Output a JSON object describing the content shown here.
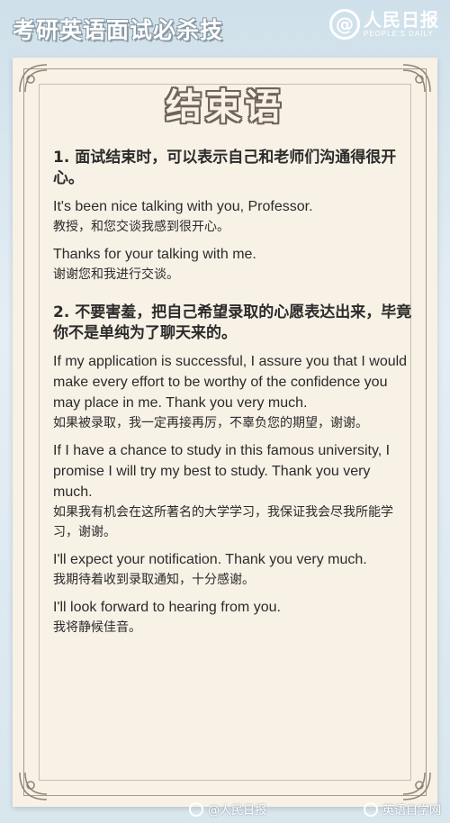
{
  "header": {
    "title": "考研英语面试必杀技",
    "brand_mark": "@",
    "brand_cn": "人民日报",
    "brand_en": "PEOPLE'S DAILY"
  },
  "section_title": "结束语",
  "items": [
    {
      "title": "1. 面试结束时，可以表示自己和老师们沟通得很开心。",
      "examples": [
        {
          "en": "It's been nice talking with you, Professor.",
          "cn": "教授，和您交谈我感到很开心。"
        },
        {
          "en": "Thanks for your talking with me.",
          "cn": "谢谢您和我进行交谈。"
        }
      ]
    },
    {
      "title": "2. 不要害羞，把自己希望录取的心愿表达出来，毕竟你不是单纯为了聊天来的。",
      "examples": [
        {
          "en": "If my application is successful, I assure you that I would make every effort to be worthy of the confidence you may place in me. Thank you very much.",
          "cn": "如果被录取，我一定再接再厉，不辜负您的期望，谢谢。"
        },
        {
          "en": "If I have a chance to study in this famous university, I promise I will try my best to study. Thank you very much.",
          "cn": "如果我有机会在这所著名的大学学习，我保证我会尽我所能学习，谢谢。"
        },
        {
          "en": "I'll expect your notification. Thank you very much.",
          "cn": "我期待着收到录取通知，十分感谢。"
        },
        {
          "en": "I'll look forward to hearing from you.",
          "cn": "我将静候佳音。"
        }
      ]
    }
  ],
  "watermarks": {
    "left": "@人民日报",
    "right": "英语自学网"
  },
  "colors": {
    "background": "#d8e6ee",
    "paper": "#f8f1e6",
    "title_outline": "#6f6258",
    "text": "#2b2b2b"
  }
}
